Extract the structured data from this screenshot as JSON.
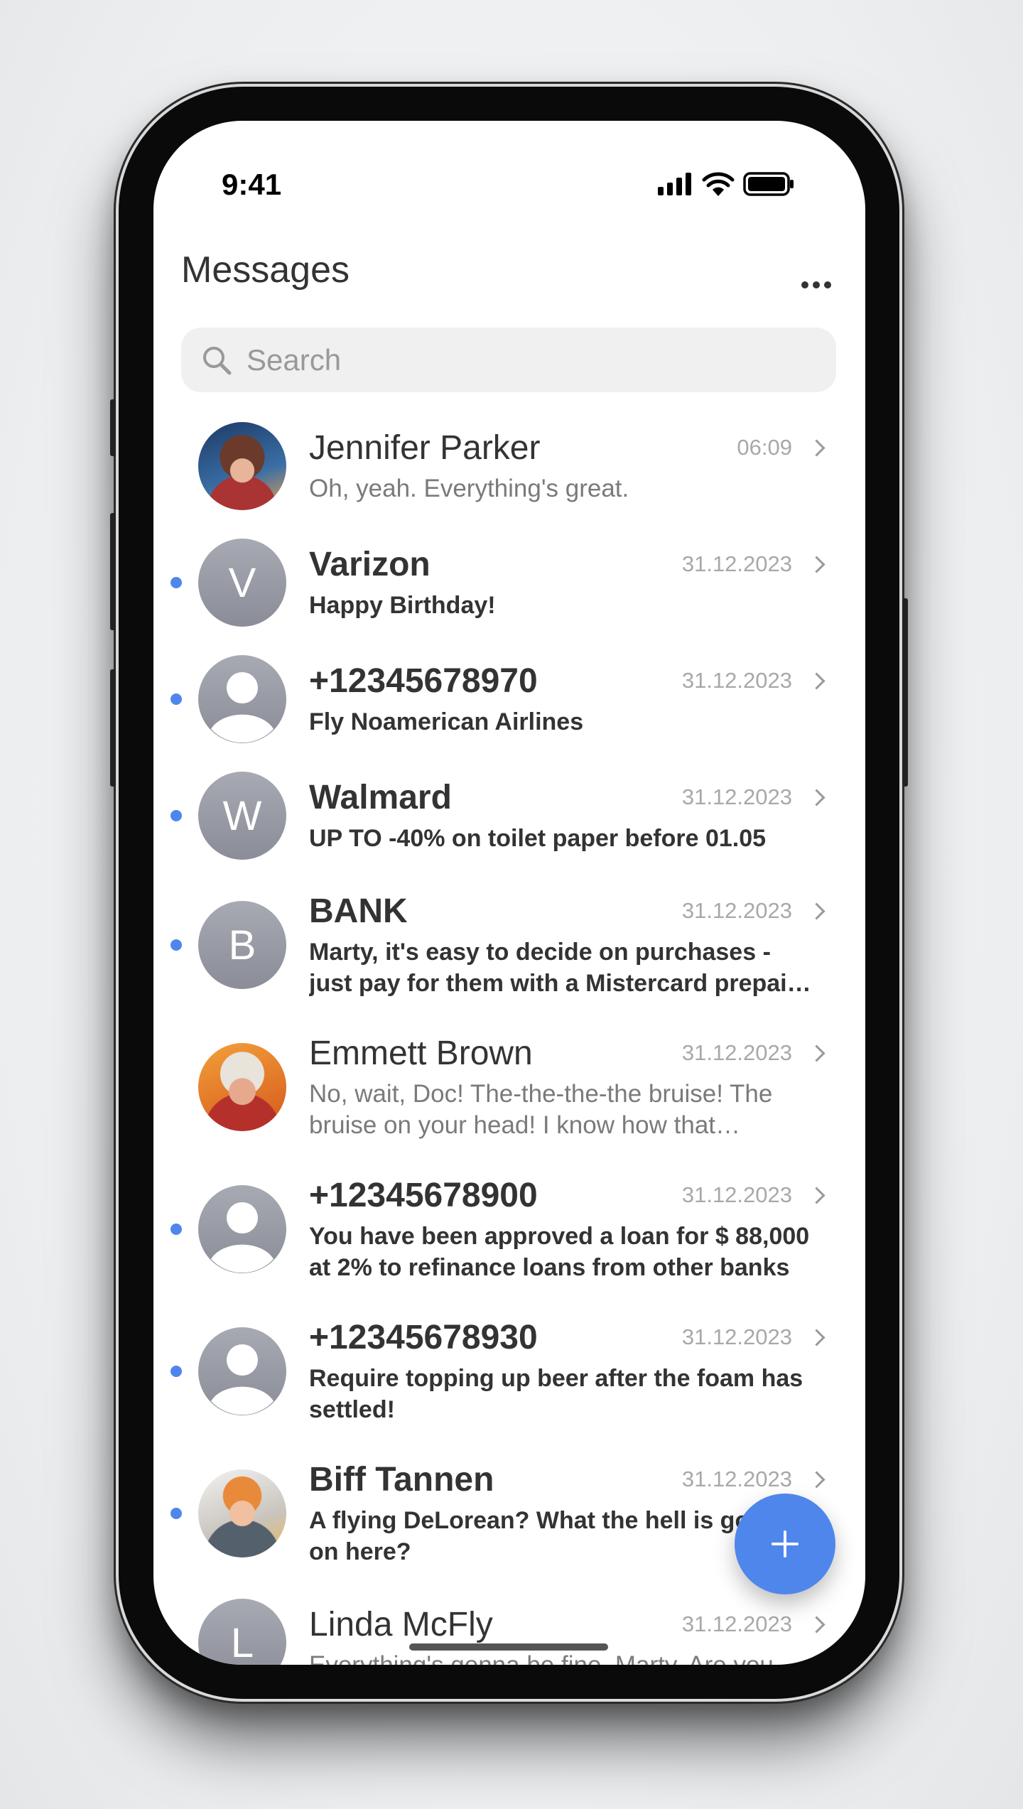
{
  "status_bar": {
    "time": "9:41",
    "icons": [
      "signal-icon",
      "wifi-icon",
      "battery-icon"
    ]
  },
  "header": {
    "title": "Messages",
    "more_icon": "ellipsis-icon"
  },
  "search": {
    "placeholder": "Search",
    "value": ""
  },
  "accent_color": "#4f86ec",
  "conversations": [
    {
      "name": "Jennifer Parker",
      "date": "06:09",
      "preview": "Oh, yeah. Everything's great.",
      "unread": false,
      "avatar": "photo"
    },
    {
      "name": "Varizon",
      "date": "31.12.2023",
      "preview": "Happy Birthday!",
      "unread": true,
      "avatar": "V"
    },
    {
      "name": "+12345678970",
      "date": "31.12.2023",
      "preview": "Fly Noamerican Airlines",
      "unread": true,
      "avatar": "person-icon"
    },
    {
      "name": "Walmard",
      "date": "31.12.2023",
      "preview": "UP TO -40% on toilet paper before 01.05",
      "unread": true,
      "avatar": "W"
    },
    {
      "name": "BANK",
      "date": "31.12.2023",
      "preview": "Marty, it's easy to decide on purchases - just pay for them with a Mistercard prepaid card",
      "unread": true,
      "avatar": "B"
    },
    {
      "name": "Emmett Brown",
      "date": "31.12.2023",
      "preview": "No, wait, Doc! The-the-the-the bruise! The bruise on your head! I know how that happened",
      "unread": false,
      "avatar": "photo"
    },
    {
      "name": "+12345678900",
      "date": "31.12.2023",
      "preview": "You have been approved a loan for $ 88,000 at 2% to refinance loans from other banks",
      "unread": true,
      "avatar": "person-icon"
    },
    {
      "name": "+12345678930",
      "date": "31.12.2023",
      "preview": "Require topping up beer after the foam has settled!",
      "unread": true,
      "avatar": "person-icon"
    },
    {
      "name": "Biff Tannen",
      "date": "31.12.2023",
      "preview": "A flying DeLorean? What the hell is going on here?",
      "unread": true,
      "avatar": "photo"
    },
    {
      "name": "Linda McFly",
      "date": "31.12.2023",
      "preview": "Everything's gonna be fine, Marty. Are you",
      "unread": false,
      "avatar": "L"
    }
  ],
  "fab": {
    "icon": "plus-icon"
  }
}
